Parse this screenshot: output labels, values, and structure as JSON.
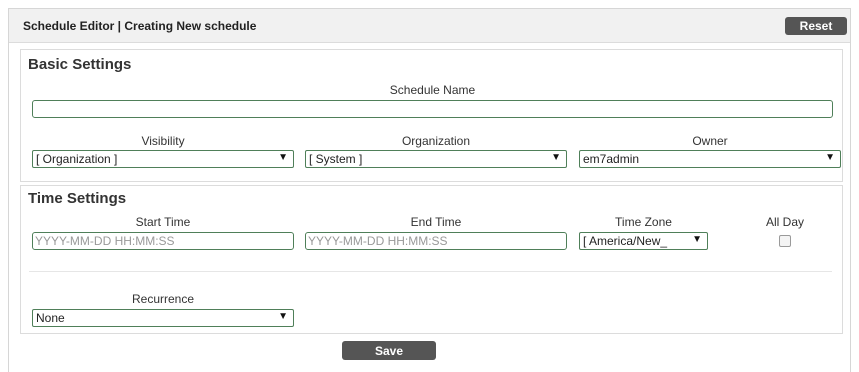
{
  "header": {
    "title": "Schedule Editor | Creating New schedule",
    "reset_label": "Reset"
  },
  "basic": {
    "title": "Basic Settings",
    "schedule_name_label": "Schedule Name",
    "schedule_name_value": "",
    "visibility_label": "Visibility",
    "visibility_value": "[ Organization ]",
    "organization_label": "Organization",
    "organization_value": "[ System ]",
    "owner_label": "Owner",
    "owner_value": "em7admin"
  },
  "time": {
    "title": "Time Settings",
    "start_label": "Start Time",
    "start_placeholder": "YYYY-MM-DD HH:MM:SS",
    "end_label": "End Time",
    "end_placeholder": "YYYY-MM-DD HH:MM:SS",
    "timezone_label": "Time Zone",
    "timezone_value": "[ America/New_",
    "allday_label": "All Day",
    "allday_checked": false,
    "recurrence_label": "Recurrence",
    "recurrence_value": "None"
  },
  "footer": {
    "save_label": "Save"
  },
  "icons": {
    "dropdown": "▼"
  },
  "colors": {
    "field_border": "#4f7f59",
    "button_bg": "#555555",
    "header_bg": "#f1f1f1"
  }
}
